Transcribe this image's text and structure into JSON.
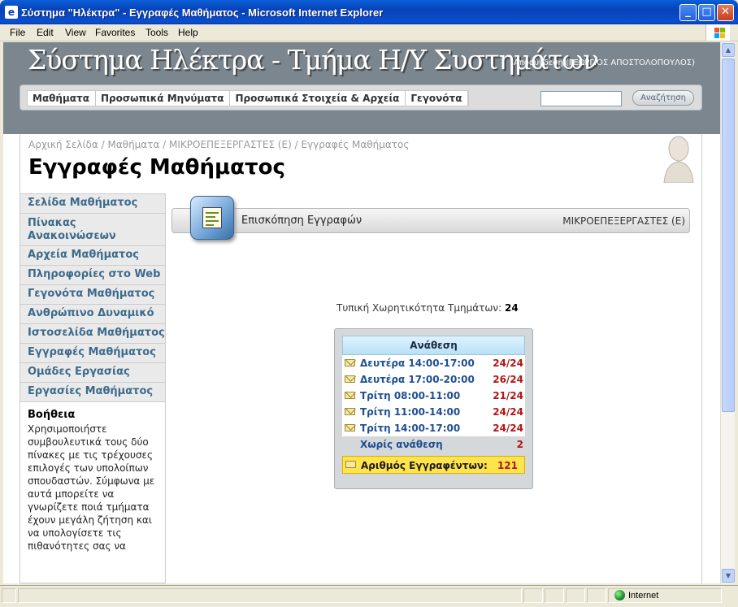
{
  "window": {
    "title": "Σύστημα \"Ηλέκτρα\" - Εγγραφές Μαθήματος - Microsoft Internet Explorer",
    "minimize": "_",
    "maximize": "□",
    "close": "✕"
  },
  "menu": [
    "File",
    "Edit",
    "View",
    "Favorites",
    "Tools",
    "Help"
  ],
  "header": {
    "site_title": "Σύστημα Ηλέκτρα - Τμήμα Η/Υ Συστημάτων",
    "logout": "Αποσύνδεση (ΓΕΩΡΓΙΟΣ ΑΠΟΣΤΟΛΟΠΟΥΛΟΣ)",
    "nav": [
      "Μαθήματα",
      "Προσωπικά Μηνύματα",
      "Προσωπικά Στοιχεία & Αρχεία",
      "Γεγονότα"
    ],
    "search_button": "Αναζήτηση",
    "search_value": ""
  },
  "breadcrumb": "Αρχική Σελίδα / Μαθήματα / ΜΙΚΡΟΕΠΕΞΕΡΓΑΣΤΕΣ (Ε) / Εγγραφές Μαθήματος",
  "page_title": "Εγγραφές Μαθήματος",
  "sidebar": {
    "items": [
      "Σελίδα Μαθήματος",
      "Πίνακας Ανακοινώσεων",
      "Αρχεία Μαθήματος",
      "Πληροφορίες στο Web",
      "Γεγονότα Μαθήματος",
      "Ανθρώπινο Δυναμικό",
      "Ιστοσελίδα Μαθήματος",
      "Εγγραφές Μαθήματος",
      "Ομάδες Εργασίας",
      "Εργασίες Μαθήματος"
    ],
    "help_title": "Βοήθεια",
    "help_text": "Χρησιμοποιήστε συμβουλευτικά τους δύο πίνακες με τις τρέχουσες επιλογές των υπολοίπων σπουδαστών. Σύμφωνα με αυτά μπορείτε να γνωρίζετε ποιά τμήματα έχουν μεγάλη ζήτηση και να υπολογίσετε τις πιθανότητες σας να"
  },
  "section": {
    "label": "Επισκόπηση Εγγραφών",
    "course": "ΜΙΚΡΟΕΠΕΞΕΡΓΑΣΤΕΣ (Ε)"
  },
  "capacity": {
    "label": "Τυπική Χωρητικότητα Τμημάτων:",
    "value": "24"
  },
  "assignment": {
    "header": "Ανάθεση",
    "rows": [
      {
        "label": "Δευτέρα 14:00-17:00",
        "value": "24/24"
      },
      {
        "label": "Δευτέρα 17:00-20:00",
        "value": "26/24"
      },
      {
        "label": "Τρίτη 08:00-11:00",
        "value": "21/24"
      },
      {
        "label": "Τρίτη 11:00-14:00",
        "value": "24/24"
      },
      {
        "label": "Τρίτη 14:00-17:00",
        "value": "24/24"
      }
    ],
    "no_assign": {
      "label": "Χωρίς ανάθεση",
      "value": "2"
    },
    "total": {
      "label": "Αριθμός Εγγραφέντων:",
      "value": "121"
    }
  },
  "status": {
    "zone": "Internet"
  }
}
